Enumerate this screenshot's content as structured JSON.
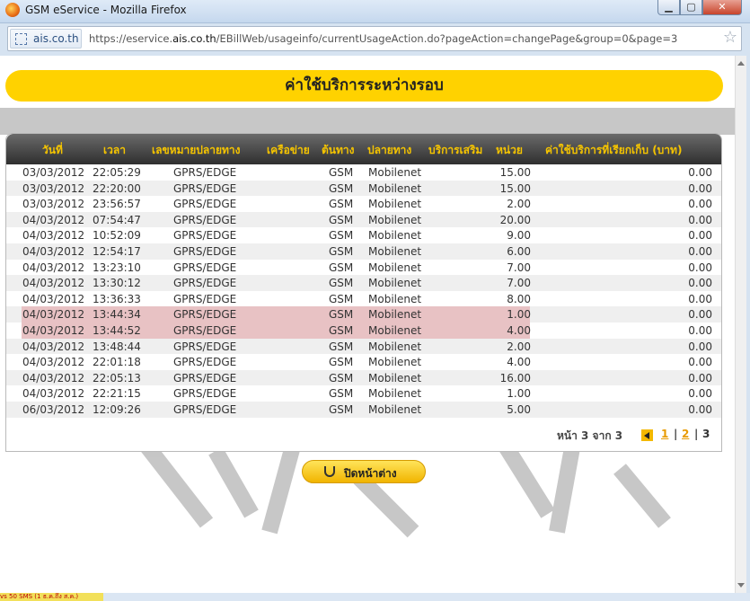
{
  "window": {
    "title": "GSM eService - Mozilla Firefox",
    "min_glyph": "▁",
    "max_glyph": "▢",
    "close_glyph": "✕"
  },
  "address_bar": {
    "site_identity": "ais.co.th",
    "url_prefix": "https://eservice.",
    "url_domain": "ais.co.th",
    "url_suffix": "/EBillWeb/usageinfo/currentUsageAction.do?pageAction=changePage&group=0&page=3",
    "star_glyph": "☆"
  },
  "page": {
    "header_title": "ค่าใช้บริการระหว่างรอบ",
    "columns": [
      "วันที่",
      "เวลา",
      "เลขหมายปลายทาง",
      "เครือข่าย",
      "ต้นทาง",
      "ปลายทาง",
      "บริการเสริม",
      "หน่วย",
      "ค่าใช้บริการที่เรียกเก็บ (บาท)"
    ],
    "rows": [
      {
        "date": "03/03/2012",
        "time": "22:05:29",
        "dest": "GPRS/EDGE",
        "network": "",
        "origin": "GSM",
        "destnet": "Mobilenet",
        "addon": "",
        "units": "15.00",
        "charge": "0.00",
        "highlight": false
      },
      {
        "date": "03/03/2012",
        "time": "22:20:00",
        "dest": "GPRS/EDGE",
        "network": "",
        "origin": "GSM",
        "destnet": "Mobilenet",
        "addon": "",
        "units": "15.00",
        "charge": "0.00",
        "highlight": false
      },
      {
        "date": "03/03/2012",
        "time": "23:56:57",
        "dest": "GPRS/EDGE",
        "network": "",
        "origin": "GSM",
        "destnet": "Mobilenet",
        "addon": "",
        "units": "2.00",
        "charge": "0.00",
        "highlight": false
      },
      {
        "date": "04/03/2012",
        "time": "07:54:47",
        "dest": "GPRS/EDGE",
        "network": "",
        "origin": "GSM",
        "destnet": "Mobilenet",
        "addon": "",
        "units": "20.00",
        "charge": "0.00",
        "highlight": false
      },
      {
        "date": "04/03/2012",
        "time": "10:52:09",
        "dest": "GPRS/EDGE",
        "network": "",
        "origin": "GSM",
        "destnet": "Mobilenet",
        "addon": "",
        "units": "9.00",
        "charge": "0.00",
        "highlight": false
      },
      {
        "date": "04/03/2012",
        "time": "12:54:17",
        "dest": "GPRS/EDGE",
        "network": "",
        "origin": "GSM",
        "destnet": "Mobilenet",
        "addon": "",
        "units": "6.00",
        "charge": "0.00",
        "highlight": false
      },
      {
        "date": "04/03/2012",
        "time": "13:23:10",
        "dest": "GPRS/EDGE",
        "network": "",
        "origin": "GSM",
        "destnet": "Mobilenet",
        "addon": "",
        "units": "7.00",
        "charge": "0.00",
        "highlight": false
      },
      {
        "date": "04/03/2012",
        "time": "13:30:12",
        "dest": "GPRS/EDGE",
        "network": "",
        "origin": "GSM",
        "destnet": "Mobilenet",
        "addon": "",
        "units": "7.00",
        "charge": "0.00",
        "highlight": false
      },
      {
        "date": "04/03/2012",
        "time": "13:36:33",
        "dest": "GPRS/EDGE",
        "network": "",
        "origin": "GSM",
        "destnet": "Mobilenet",
        "addon": "",
        "units": "8.00",
        "charge": "0.00",
        "highlight": false
      },
      {
        "date": "04/03/2012",
        "time": "13:44:34",
        "dest": "GPRS/EDGE",
        "network": "",
        "origin": "GSM",
        "destnet": "Mobilenet",
        "addon": "",
        "units": "1.00",
        "charge": "0.00",
        "highlight": true
      },
      {
        "date": "04/03/2012",
        "time": "13:44:52",
        "dest": "GPRS/EDGE",
        "network": "",
        "origin": "GSM",
        "destnet": "Mobilenet",
        "addon": "",
        "units": "4.00",
        "charge": "0.00",
        "highlight": true
      },
      {
        "date": "04/03/2012",
        "time": "13:48:44",
        "dest": "GPRS/EDGE",
        "network": "",
        "origin": "GSM",
        "destnet": "Mobilenet",
        "addon": "",
        "units": "2.00",
        "charge": "0.00",
        "highlight": false
      },
      {
        "date": "04/03/2012",
        "time": "22:01:18",
        "dest": "GPRS/EDGE",
        "network": "",
        "origin": "GSM",
        "destnet": "Mobilenet",
        "addon": "",
        "units": "4.00",
        "charge": "0.00",
        "highlight": false
      },
      {
        "date": "04/03/2012",
        "time": "22:05:13",
        "dest": "GPRS/EDGE",
        "network": "",
        "origin": "GSM",
        "destnet": "Mobilenet",
        "addon": "",
        "units": "16.00",
        "charge": "0.00",
        "highlight": false
      },
      {
        "date": "04/03/2012",
        "time": "22:21:15",
        "dest": "GPRS/EDGE",
        "network": "",
        "origin": "GSM",
        "destnet": "Mobilenet",
        "addon": "",
        "units": "1.00",
        "charge": "0.00",
        "highlight": false
      },
      {
        "date": "06/03/2012",
        "time": "12:09:26",
        "dest": "GPRS/EDGE",
        "network": "",
        "origin": "GSM",
        "destnet": "Mobilenet",
        "addon": "",
        "units": "5.00",
        "charge": "0.00",
        "highlight": false
      }
    ],
    "pager": {
      "label": "หน้า 3 จาก 3",
      "page_1": "1",
      "page_2": "2",
      "current": "3",
      "separator": "|"
    },
    "close_button_label": "ปิดหน้าต่าง"
  },
  "taskbar": {
    "item_text": "vs 50 SMS (1 ธ.ค.ถึง ส.ค.)"
  },
  "colors": {
    "accent_yellow": "#ffd200",
    "header_text": "#f5c400",
    "highlight_row": "#e8c2c4",
    "pager_link": "#e89a00"
  }
}
